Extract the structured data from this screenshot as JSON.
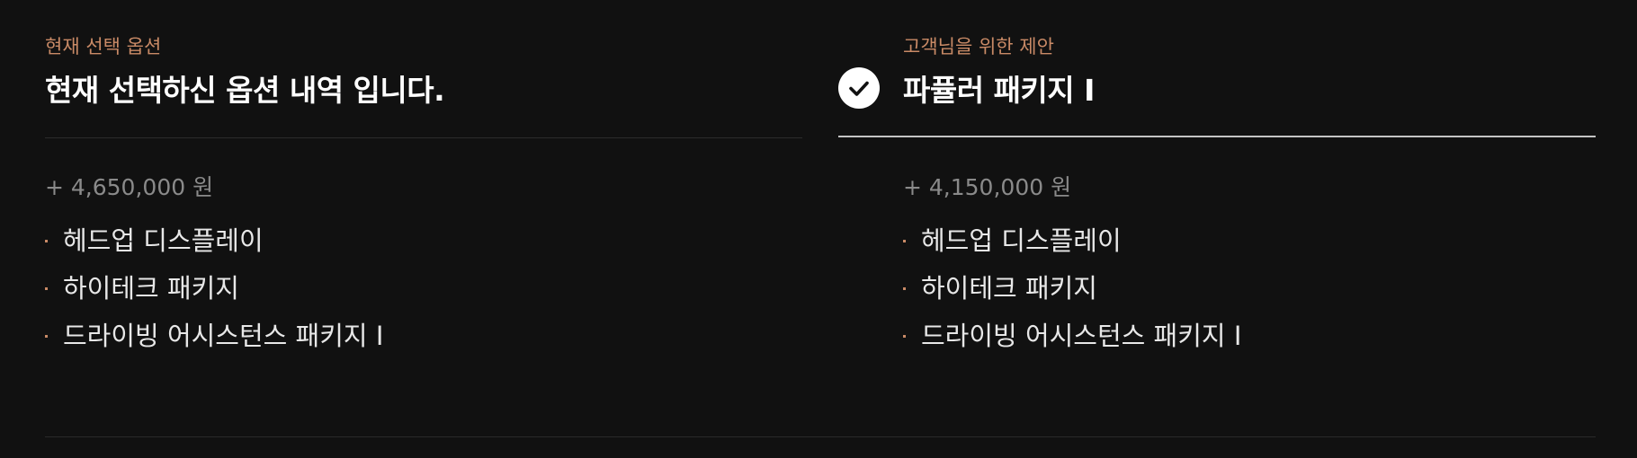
{
  "current": {
    "eyebrow": "현재 선택 옵션",
    "title": "현재 선택하신 옵션 내역 입니다.",
    "price": "+ 4,650,000 원",
    "features": [
      "헤드업 디스플레이",
      "하이테크 패키지",
      "드라이빙 어시스턴스 패키지 I"
    ]
  },
  "offer": {
    "eyebrow": "고객님을 위한 제안",
    "title": "파퓰러 패키지 I",
    "selected": true,
    "check_icon": "check-circle-icon",
    "price": "+ 4,150,000 원",
    "features": [
      "헤드업 디스플레이",
      "하이테크 패키지",
      "드라이빙 어시스턴스 패키지 I"
    ]
  },
  "colors": {
    "background": "#111111",
    "accent": "#c98a66",
    "price_text": "#8a8a8a",
    "selected_divider": "#c4c4c4"
  }
}
